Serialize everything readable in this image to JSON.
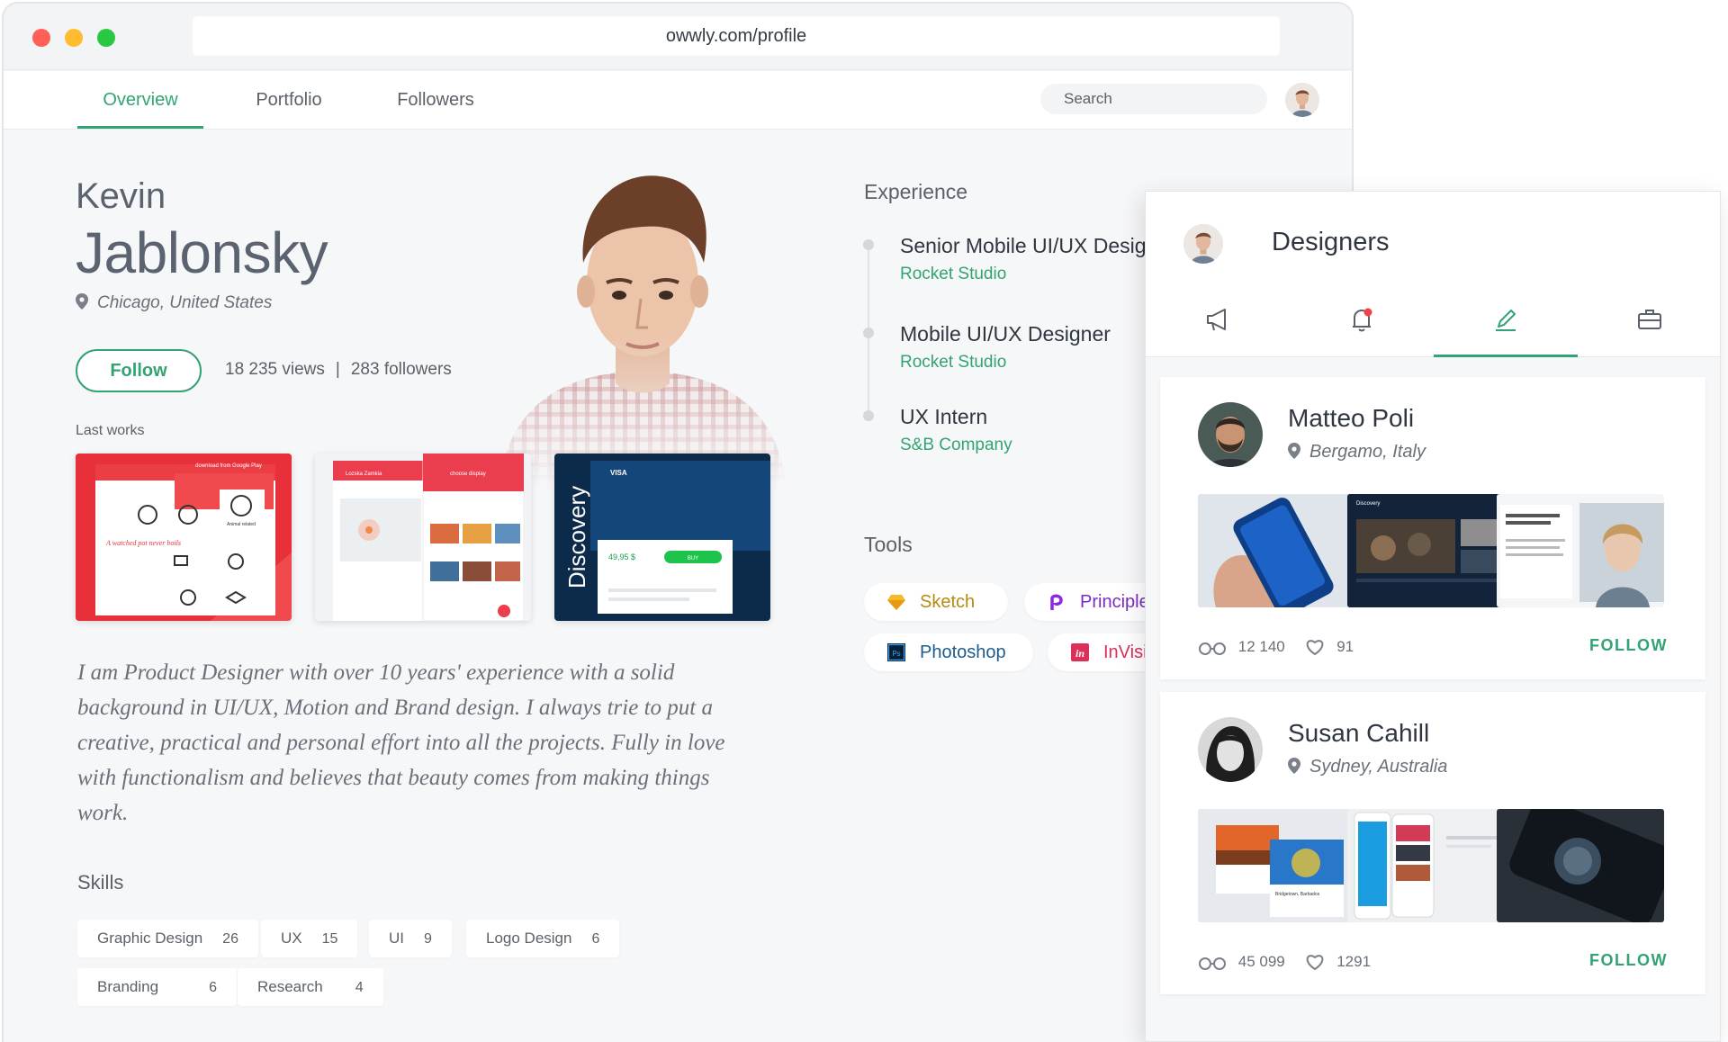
{
  "browser": {
    "url": "owwly.com/profile"
  },
  "nav": {
    "tabs": [
      "Overview",
      "Portfolio",
      "Followers"
    ],
    "search_placeholder": "Search"
  },
  "profile": {
    "first_name": "Kevin",
    "last_name": "Jablonsky",
    "location": "Chicago, United States",
    "follow_label": "Follow",
    "views": "18 235 views",
    "followers": "283 followers",
    "stats_separator": "|",
    "last_works_label": "Last works",
    "bio": "I am Product Designer with over 10 years' experience with a solid background in UI/UX, Motion and Brand design. I always trie to put a creative, practical and personal effort into all the projects. Fully in love with functionalism and believes that beauty comes from making things work."
  },
  "works": {
    "w1": {
      "banner": "download from Google Play",
      "script": "A watched pot never boils",
      "label": "Animal related"
    },
    "w2": {
      "banner": "Lozska Zamkia",
      "sub": "choose display"
    },
    "w3": {
      "brand": "VISA",
      "price": "49,95 $",
      "button": "BUY",
      "side": "Discovery"
    }
  },
  "experience": {
    "label": "Experience",
    "items": [
      {
        "title": "Senior Mobile UI/UX Designer",
        "company": "Rocket Studio"
      },
      {
        "title": "Mobile UI/UX Designer",
        "company": "Rocket Studio"
      },
      {
        "title": "UX Intern",
        "company": "S&B Company"
      }
    ]
  },
  "tools": {
    "label": "Tools",
    "items": [
      {
        "name": "Sketch",
        "color": "#b88a12"
      },
      {
        "name": "Principle",
        "color": "#7b2cbf"
      },
      {
        "name": "Photoshop",
        "color": "#1c5c8e"
      },
      {
        "name": "InVision",
        "color": "#dc2f5a"
      }
    ]
  },
  "skills": {
    "label": "Skills",
    "items": [
      {
        "name": "Graphic Design",
        "count": "26"
      },
      {
        "name": "UX",
        "count": "15"
      },
      {
        "name": "UI",
        "count": "9"
      },
      {
        "name": "Logo Design",
        "count": "6"
      },
      {
        "name": "Branding",
        "count": "6"
      },
      {
        "name": "Research",
        "count": "4"
      }
    ]
  },
  "designers": {
    "title": "Designers",
    "tabs": [
      "megaphone-icon",
      "bell-icon",
      "pencil-icon",
      "briefcase-icon"
    ],
    "active_tab": 2,
    "cards": [
      {
        "name": "Matteo Poli",
        "location": "Bergamo, Italy",
        "views": "12 140",
        "likes": "91",
        "follow_label": "FOLLOW",
        "thumb_text": "Discovery"
      },
      {
        "name": "Susan Cahill",
        "location": "Sydney, Australia",
        "views": "45 099",
        "likes": "1291",
        "follow_label": "FOLLOW",
        "thumb_text": "Bridgetown, Barbados"
      }
    ]
  },
  "colors": {
    "accent": "#34a373",
    "text_dark": "#2f3640",
    "text_muted": "#5b6168"
  }
}
